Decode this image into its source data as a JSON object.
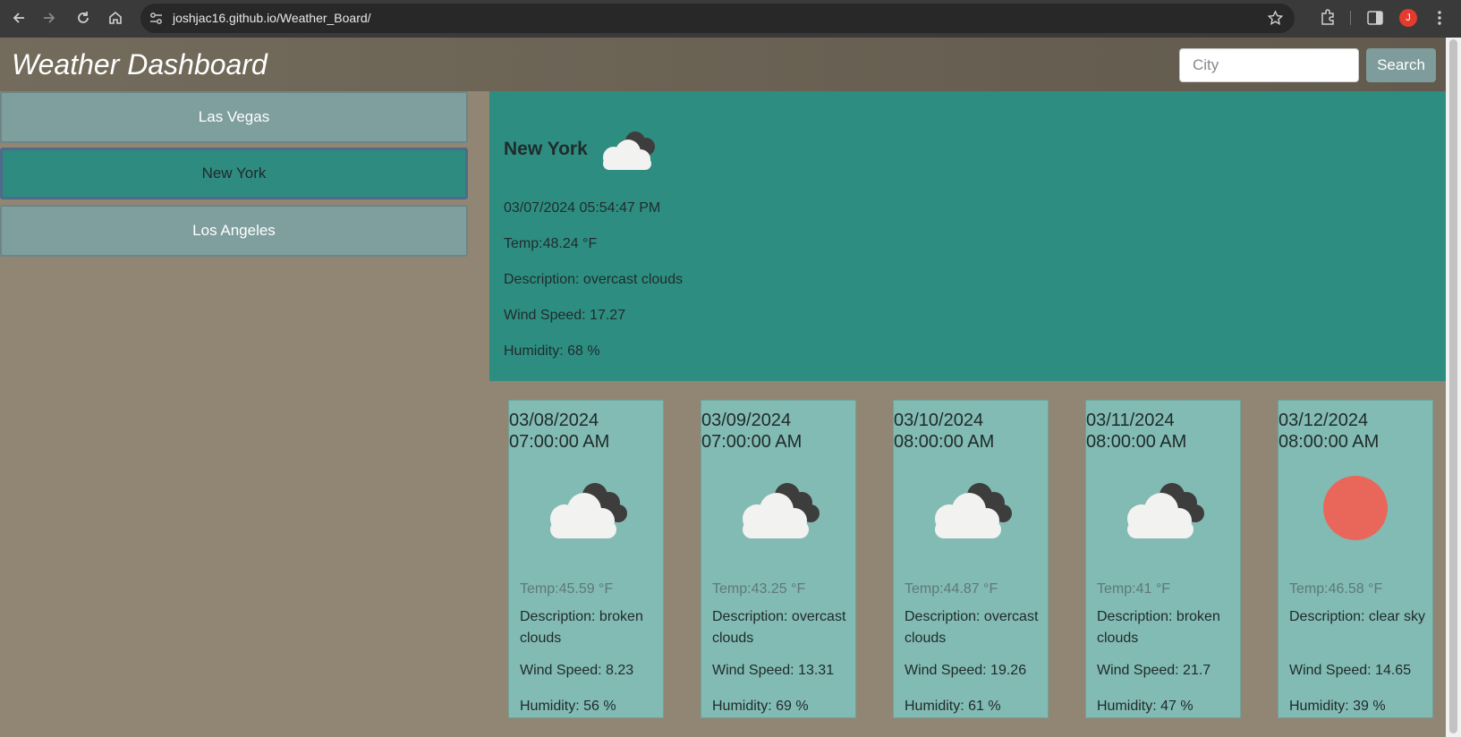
{
  "browser": {
    "url": "joshjac16.github.io/Weather_Board/",
    "avatar_letter": "J"
  },
  "header": {
    "title": "Weather Dashboard",
    "city_placeholder": "City",
    "search_label": "Search"
  },
  "history": [
    {
      "label": "Las Vegas",
      "active": false
    },
    {
      "label": "New York",
      "active": true
    },
    {
      "label": "Los Angeles",
      "active": false
    }
  ],
  "today": {
    "city": "New York",
    "icon": "overcast-clouds-icon",
    "datetime": "03/07/2024 05:54:47 PM",
    "temp": "Temp:48.24 °F",
    "description": "Description: overcast clouds",
    "wind": "Wind Speed: 17.27",
    "humidity": "Humidity: 68 %"
  },
  "forecast": [
    {
      "date": "03/08/2024",
      "time": "07:00:00 AM",
      "icon": "broken-clouds-icon",
      "temp": "Temp:45.59 °F",
      "description": "Description: broken clouds",
      "wind": "Wind Speed: 8.23",
      "humidity": "Humidity: 56 %"
    },
    {
      "date": "03/09/2024",
      "time": "07:00:00 AM",
      "icon": "overcast-clouds-icon",
      "temp": "Temp:43.25 °F",
      "description": "Description: overcast clouds",
      "wind": "Wind Speed: 13.31",
      "humidity": "Humidity: 69 %"
    },
    {
      "date": "03/10/2024",
      "time": "08:00:00 AM",
      "icon": "overcast-clouds-icon",
      "temp": "Temp:44.87 °F",
      "description": "Description: overcast clouds",
      "wind": "Wind Speed: 19.26",
      "humidity": "Humidity: 61 %"
    },
    {
      "date": "03/11/2024",
      "time": "08:00:00 AM",
      "icon": "broken-clouds-icon",
      "temp": "Temp:41 °F",
      "description": "Description: broken clouds",
      "wind": "Wind Speed: 21.7",
      "humidity": "Humidity: 47 %"
    },
    {
      "date": "03/12/2024",
      "time": "08:00:00 AM",
      "icon": "clear-sky-icon",
      "temp": "Temp:46.58 °F",
      "description": "Description: clear sky",
      "wind": "Wind Speed: 14.65",
      "humidity": "Humidity: 39 %"
    }
  ],
  "colors": {
    "page_bg": "#908673",
    "today_bg": "#2e8d81",
    "card_bg": "#82bbb3",
    "history_bg": "#7f9e9e",
    "sun": "#e8675a"
  }
}
